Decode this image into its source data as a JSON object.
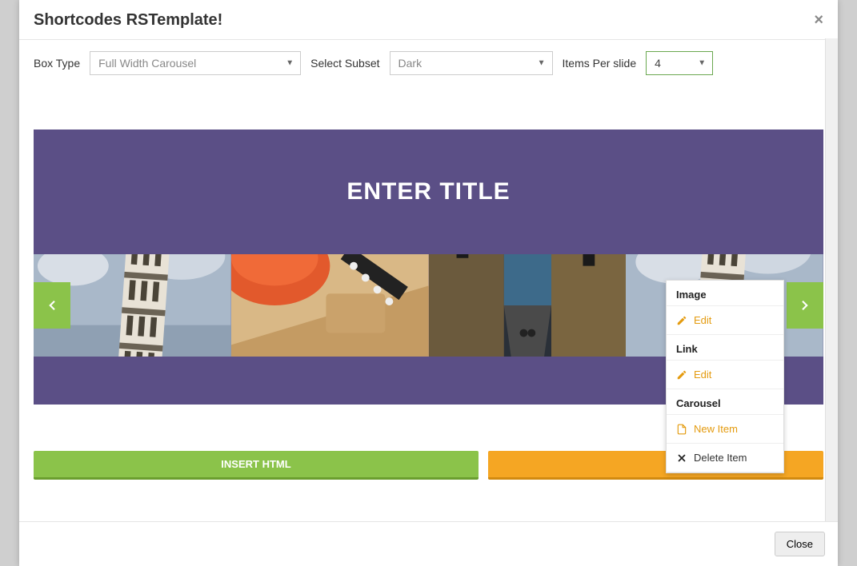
{
  "header": {
    "title": "Shortcodes RSTemplate!",
    "close_icon": "×"
  },
  "controls": {
    "box_type_label": "Box Type",
    "box_type_value": "Full Width Carousel",
    "subset_label": "Select Subset",
    "subset_value": "Dark",
    "items_label": "Items Per slide",
    "items_value": "4"
  },
  "carousel": {
    "title": "ENTER TITLE"
  },
  "buttons": {
    "insert": "INSERT HTML"
  },
  "context_menu": {
    "section_image": "Image",
    "edit_image": "Edit",
    "section_link": "Link",
    "edit_link": "Edit",
    "section_carousel": "Carousel",
    "new_item": "New Item",
    "delete_item": "Delete Item"
  },
  "footer": {
    "close": "Close"
  }
}
